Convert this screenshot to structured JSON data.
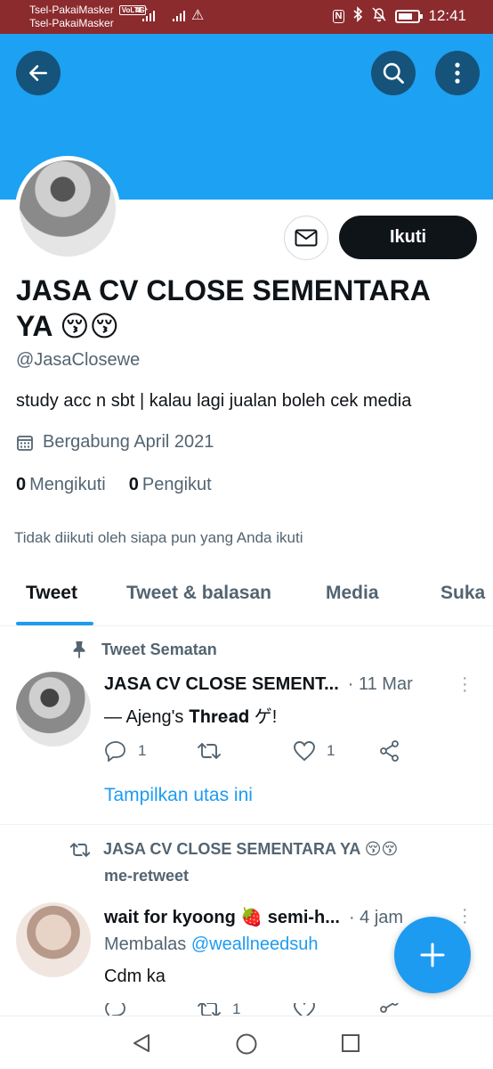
{
  "status_bar": {
    "carrier1": "Tsel-PakaiMasker",
    "volte": "VoLTE",
    "network": "4G⁺",
    "carrier2": "Tsel-PakaiMasker",
    "time": "12:41",
    "nfc": "N"
  },
  "header": {
    "back_icon": "arrow-left-icon",
    "search_icon": "search-icon",
    "more_icon": "more-vertical-icon",
    "banner_color": "#1da1f2"
  },
  "profile": {
    "display_name": "JASA CV CLOSE SEMENTARA YA 😚😚",
    "handle": "@JasaClosewe",
    "bio": "study acc n sbt | kalau lagi jualan boleh cek media",
    "joined": "Bergabung April 2021",
    "following_count": "0",
    "following_label": "Mengikuti",
    "followers_count": "0",
    "followers_label": "Pengikut",
    "not_followed_text": "Tidak diikuti oleh siapa pun yang Anda ikuti",
    "follow_button": "Ikuti"
  },
  "tabs": [
    {
      "label": "Tweet",
      "active": true
    },
    {
      "label": "Tweet & balasan",
      "active": false
    },
    {
      "label": "Media",
      "active": false
    },
    {
      "label": "Suka",
      "active": false
    }
  ],
  "tweets": [
    {
      "context": "Tweet Sematan",
      "name": "JASA CV CLOSE SEMENT...",
      "time": "· 11 Mar",
      "text": "— Ajeng's 𝐓𝐡𝐫𝐞𝐚𝐝 ゲ!",
      "reply_count": "1",
      "retweet_count": "",
      "like_count": "1",
      "show_thread": "Tampilkan utas ini"
    },
    {
      "context": "JASA CV CLOSE SEMENTARA YA 😚😚",
      "context_sub": "me-retweet",
      "name": "wait for kyoong 🍓 semi-h...",
      "time": "· 4 jam",
      "reply_prefix": "Membalas",
      "reply_mention": "@weallneedsuh",
      "text": "Cdm ka",
      "retweet_count": "1"
    }
  ],
  "accent_color": "#1d9bf0"
}
